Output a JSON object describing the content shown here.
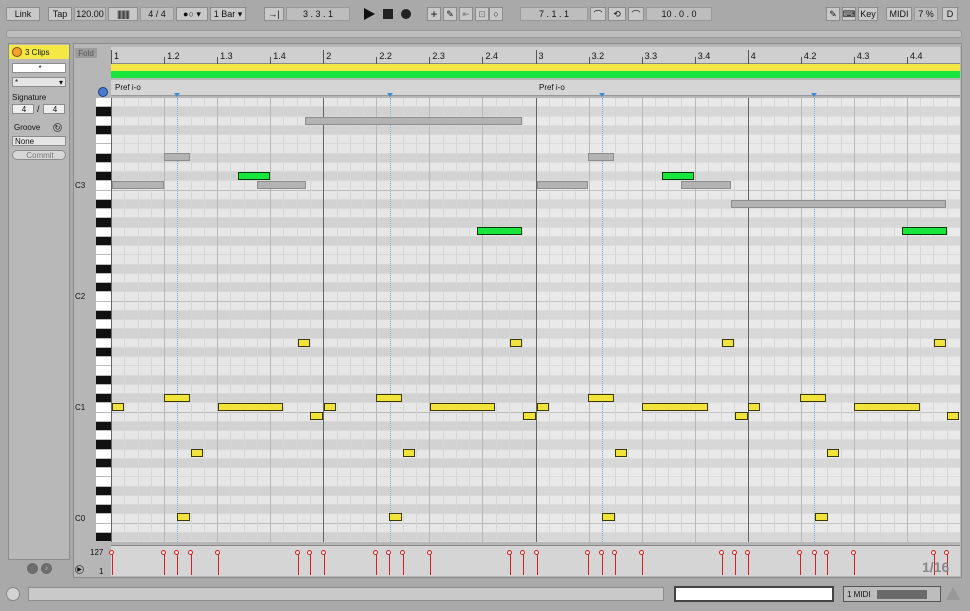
{
  "transport": {
    "link": "Link",
    "tap": "Tap",
    "tempo": "120.00",
    "sig_num": "4",
    "sig_den": "4",
    "quantize": "1 Bar",
    "position": "3 .  3 .  1",
    "loop_start": "7 .  1 .  1",
    "loop_length": "10 .  0 .  0",
    "key": "Key",
    "midi": "MIDI",
    "cpu": "7 %",
    "d": "D"
  },
  "clip_panel": {
    "title": "3 Clips",
    "name_field": "*",
    "color_field": "*",
    "signature_label": "Signature",
    "sig_num": "4",
    "sig_den": "4",
    "groove_label": "Groove",
    "groove_value": "None",
    "commit": "Commit"
  },
  "editor": {
    "fold": "Fold",
    "ruler": [
      "1",
      "1.2",
      "1.3",
      "1.4",
      "2",
      "2.2",
      "2.3",
      "2.4",
      "3",
      "3.2",
      "3.3",
      "3.4",
      "4",
      "4.2",
      "4.3",
      "4.4"
    ],
    "clip_label_1": "Pref i-o",
    "clip_label_2": "Pref i-o",
    "pitch_labels": [
      "C3",
      "C2",
      "C1",
      "C0"
    ],
    "velocity_max": "127",
    "velocity_min": "1",
    "grid": "1/16"
  },
  "status": {
    "track": "1 MIDI"
  },
  "colors": {
    "note_yellow": "#f2e33a",
    "note_green": "#19e63c",
    "loop_bar": "#a6e83a",
    "clip_title_bg": "#f3e845",
    "velocity": "#d42020"
  }
}
